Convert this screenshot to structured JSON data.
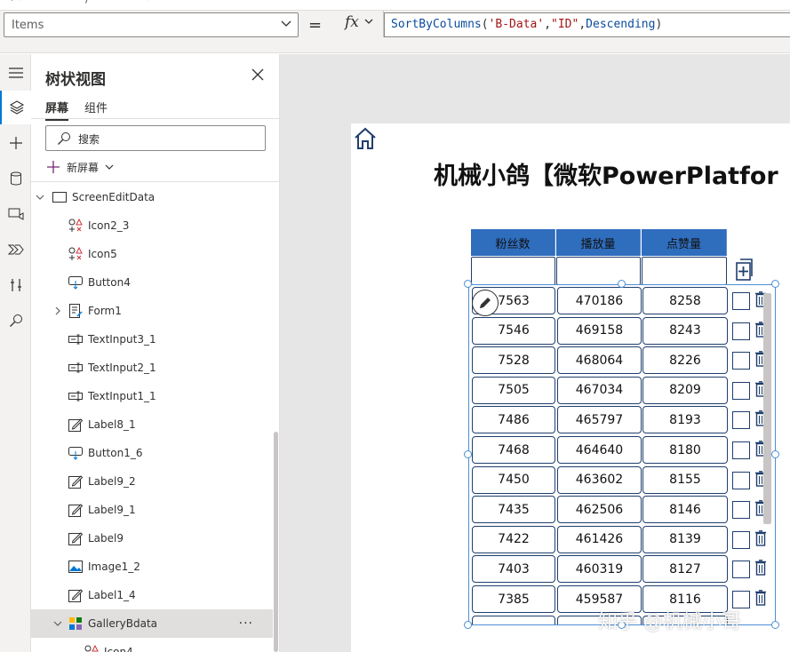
{
  "formula_bar": {
    "property": "Items",
    "equals": "=",
    "fx_label": "fx",
    "formula_tokens": [
      {
        "t": "SortByColumns",
        "k": "fn"
      },
      {
        "t": "(",
        "k": "p"
      },
      {
        "t": "'B-Data'",
        "k": "str"
      },
      {
        "t": ",",
        "k": "p"
      },
      {
        "t": "\"ID\"",
        "k": "str"
      },
      {
        "t": ",",
        "k": "p"
      },
      {
        "t": "Descending",
        "k": "kw"
      },
      {
        "t": ")",
        "k": "p"
      }
    ]
  },
  "tree_view": {
    "title": "树状视图",
    "tabs": {
      "screens": "屏幕",
      "components": "组件"
    },
    "search_placeholder": "搜索",
    "new_screen": "新屏幕",
    "nodes": [
      {
        "label": "ScreenEditData",
        "icon": "screen-icon",
        "level": 0,
        "expand": "down"
      },
      {
        "label": "Icon2_3",
        "icon": "icons-control-icon",
        "level": 1
      },
      {
        "label": "Icon5",
        "icon": "icons-control-icon",
        "level": 1
      },
      {
        "label": "Button4",
        "icon": "button-control-icon",
        "level": 1
      },
      {
        "label": "Form1",
        "icon": "form-control-icon",
        "level": 1,
        "expand": "right"
      },
      {
        "label": "TextInput3_1",
        "icon": "text-input-icon",
        "level": 1
      },
      {
        "label": "TextInput2_1",
        "icon": "text-input-icon",
        "level": 1
      },
      {
        "label": "TextInput1_1",
        "icon": "text-input-icon",
        "level": 1
      },
      {
        "label": "Label8_1",
        "icon": "label-control-icon",
        "level": 1
      },
      {
        "label": "Button1_6",
        "icon": "button-control-icon",
        "level": 1
      },
      {
        "label": "Label9_2",
        "icon": "label-control-icon",
        "level": 1
      },
      {
        "label": "Label9_1",
        "icon": "label-control-icon",
        "level": 1
      },
      {
        "label": "Label9",
        "icon": "label-control-icon",
        "level": 1
      },
      {
        "label": "Image1_2",
        "icon": "image-control-icon",
        "level": 1
      },
      {
        "label": "Label1_4",
        "icon": "label-control-icon",
        "level": 1
      },
      {
        "label": "GalleryBdata",
        "icon": "gallery-control-icon",
        "level": 1,
        "expand": "down",
        "selected": true,
        "more": "···"
      },
      {
        "label": "Icon4",
        "icon": "icons-control-icon",
        "level": 2
      }
    ]
  },
  "app": {
    "title": "机械小鸽【微软PowerPlatfor",
    "columns": [
      "粉丝数",
      "播放量",
      "点赞量"
    ],
    "rows": [
      {
        "fans": "7563",
        "plays": "470186",
        "likes": "8258"
      },
      {
        "fans": "7546",
        "plays": "469158",
        "likes": "8243"
      },
      {
        "fans": "7528",
        "plays": "468064",
        "likes": "8226"
      },
      {
        "fans": "7505",
        "plays": "467034",
        "likes": "8209"
      },
      {
        "fans": "7486",
        "plays": "465797",
        "likes": "8193"
      },
      {
        "fans": "7468",
        "plays": "464640",
        "likes": "8180"
      },
      {
        "fans": "7450",
        "plays": "463602",
        "likes": "8155"
      },
      {
        "fans": "7435",
        "plays": "462506",
        "likes": "8146"
      },
      {
        "fans": "7422",
        "plays": "461426",
        "likes": "8139"
      },
      {
        "fans": "7403",
        "plays": "460319",
        "likes": "8127"
      },
      {
        "fans": "7385",
        "plays": "459587",
        "likes": "8116"
      }
    ]
  },
  "watermark": "知乎 @机械小哥",
  "colors": {
    "header_blue": "#2f6dbd",
    "accent": "#0078d4",
    "cell_border": "#1f3f6e"
  }
}
